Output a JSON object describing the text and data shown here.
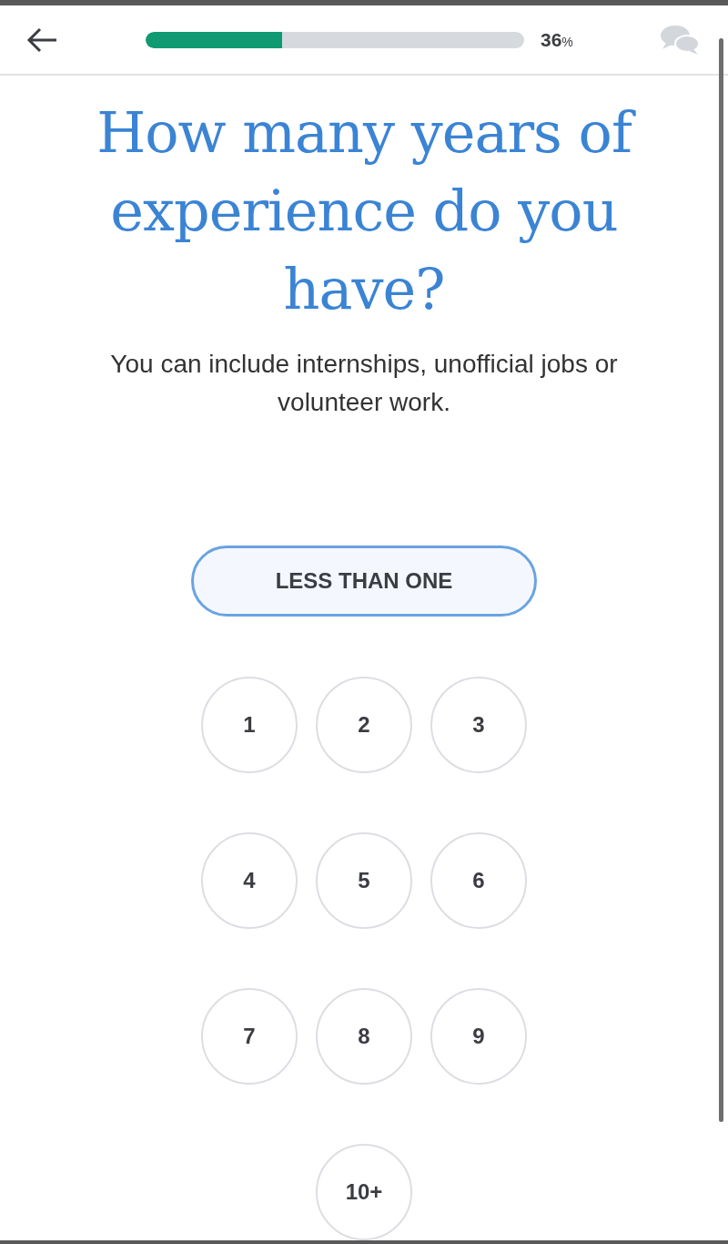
{
  "header": {
    "progress": {
      "level": 0.36,
      "reading": "36",
      "unit": "%"
    }
  },
  "question": {
    "title": "How many years of experience do you have?",
    "subtitle": "You can include internships, unofficial jobs or volunteer work."
  },
  "options": [
    {
      "kind": "wide",
      "label": "LESS THAN ONE",
      "selected": true
    },
    {
      "kind": "round",
      "label": "1",
      "selected": false
    },
    {
      "kind": "round",
      "label": "2",
      "selected": false
    },
    {
      "kind": "round",
      "label": "3",
      "selected": false
    },
    {
      "kind": "round",
      "label": "4",
      "selected": false
    },
    {
      "kind": "round",
      "label": "5",
      "selected": false
    },
    {
      "kind": "round",
      "label": "6",
      "selected": false
    },
    {
      "kind": "round",
      "label": "7",
      "selected": false
    },
    {
      "kind": "round",
      "label": "8",
      "selected": false
    },
    {
      "kind": "round",
      "label": "9",
      "selected": false
    },
    {
      "kind": "round",
      "label": "10+",
      "selected": false
    }
  ]
}
